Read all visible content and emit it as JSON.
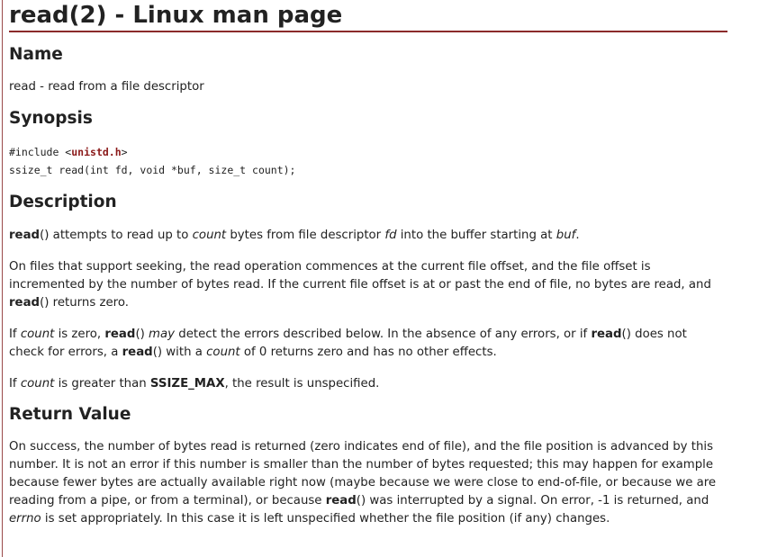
{
  "title": "read(2) - Linux man page",
  "sections": {
    "name": {
      "heading": "Name",
      "text": "read - read from a file descriptor"
    },
    "synopsis": {
      "heading": "Synopsis",
      "include_prefix": "#include <",
      "include_link": "unistd.h",
      "include_suffix": ">",
      "prototype": "ssize_t read(int fd, void *buf, size_t count);"
    },
    "description": {
      "heading": "Description",
      "paragraphs": [
        [
          {
            "t": "b",
            "v": "read"
          },
          {
            "t": "n",
            "v": "() attempts to read up to "
          },
          {
            "t": "i",
            "v": "count"
          },
          {
            "t": "n",
            "v": " bytes from file descriptor "
          },
          {
            "t": "i",
            "v": "fd"
          },
          {
            "t": "n",
            "v": " into the buffer starting at "
          },
          {
            "t": "i",
            "v": "buf"
          },
          {
            "t": "n",
            "v": "."
          }
        ],
        [
          {
            "t": "n",
            "v": "On files that support seeking, the read operation commences at the current file offset, and the file offset is incremented by the number of bytes read. If the current file offset is at or past the end of file, no bytes are read, and "
          },
          {
            "t": "b",
            "v": "read"
          },
          {
            "t": "n",
            "v": "() returns zero."
          }
        ],
        [
          {
            "t": "n",
            "v": "If "
          },
          {
            "t": "i",
            "v": "count"
          },
          {
            "t": "n",
            "v": " is zero, "
          },
          {
            "t": "b",
            "v": "read"
          },
          {
            "t": "n",
            "v": "() "
          },
          {
            "t": "i",
            "v": "may"
          },
          {
            "t": "n",
            "v": " detect the errors described below. In the absence of any errors, or if "
          },
          {
            "t": "b",
            "v": "read"
          },
          {
            "t": "n",
            "v": "() does not check for errors, a "
          },
          {
            "t": "b",
            "v": "read"
          },
          {
            "t": "n",
            "v": "() with a "
          },
          {
            "t": "i",
            "v": "count"
          },
          {
            "t": "n",
            "v": " of 0 returns zero and has no other effects."
          }
        ],
        [
          {
            "t": "n",
            "v": "If "
          },
          {
            "t": "i",
            "v": "count"
          },
          {
            "t": "n",
            "v": " is greater than "
          },
          {
            "t": "b",
            "v": "SSIZE_MAX"
          },
          {
            "t": "n",
            "v": ", the result is unspecified."
          }
        ]
      ]
    },
    "return_value": {
      "heading": "Return Value",
      "paragraphs": [
        [
          {
            "t": "n",
            "v": "On success, the number of bytes read is returned (zero indicates end of file), and the file position is advanced by this number. It is not an error if this number is smaller than the number of bytes requested; this may happen for example because fewer bytes are actually available right now (maybe because we were close to end-of-file, or because we are reading from a pipe, or from a terminal), or because "
          },
          {
            "t": "b",
            "v": "read"
          },
          {
            "t": "n",
            "v": "() was interrupted by a signal. On error, -1 is returned, and "
          },
          {
            "t": "i",
            "v": "errno"
          },
          {
            "t": "n",
            "v": " is set appropriately. In this case it is left unspecified whether the file position (if any) changes."
          }
        ]
      ]
    }
  }
}
